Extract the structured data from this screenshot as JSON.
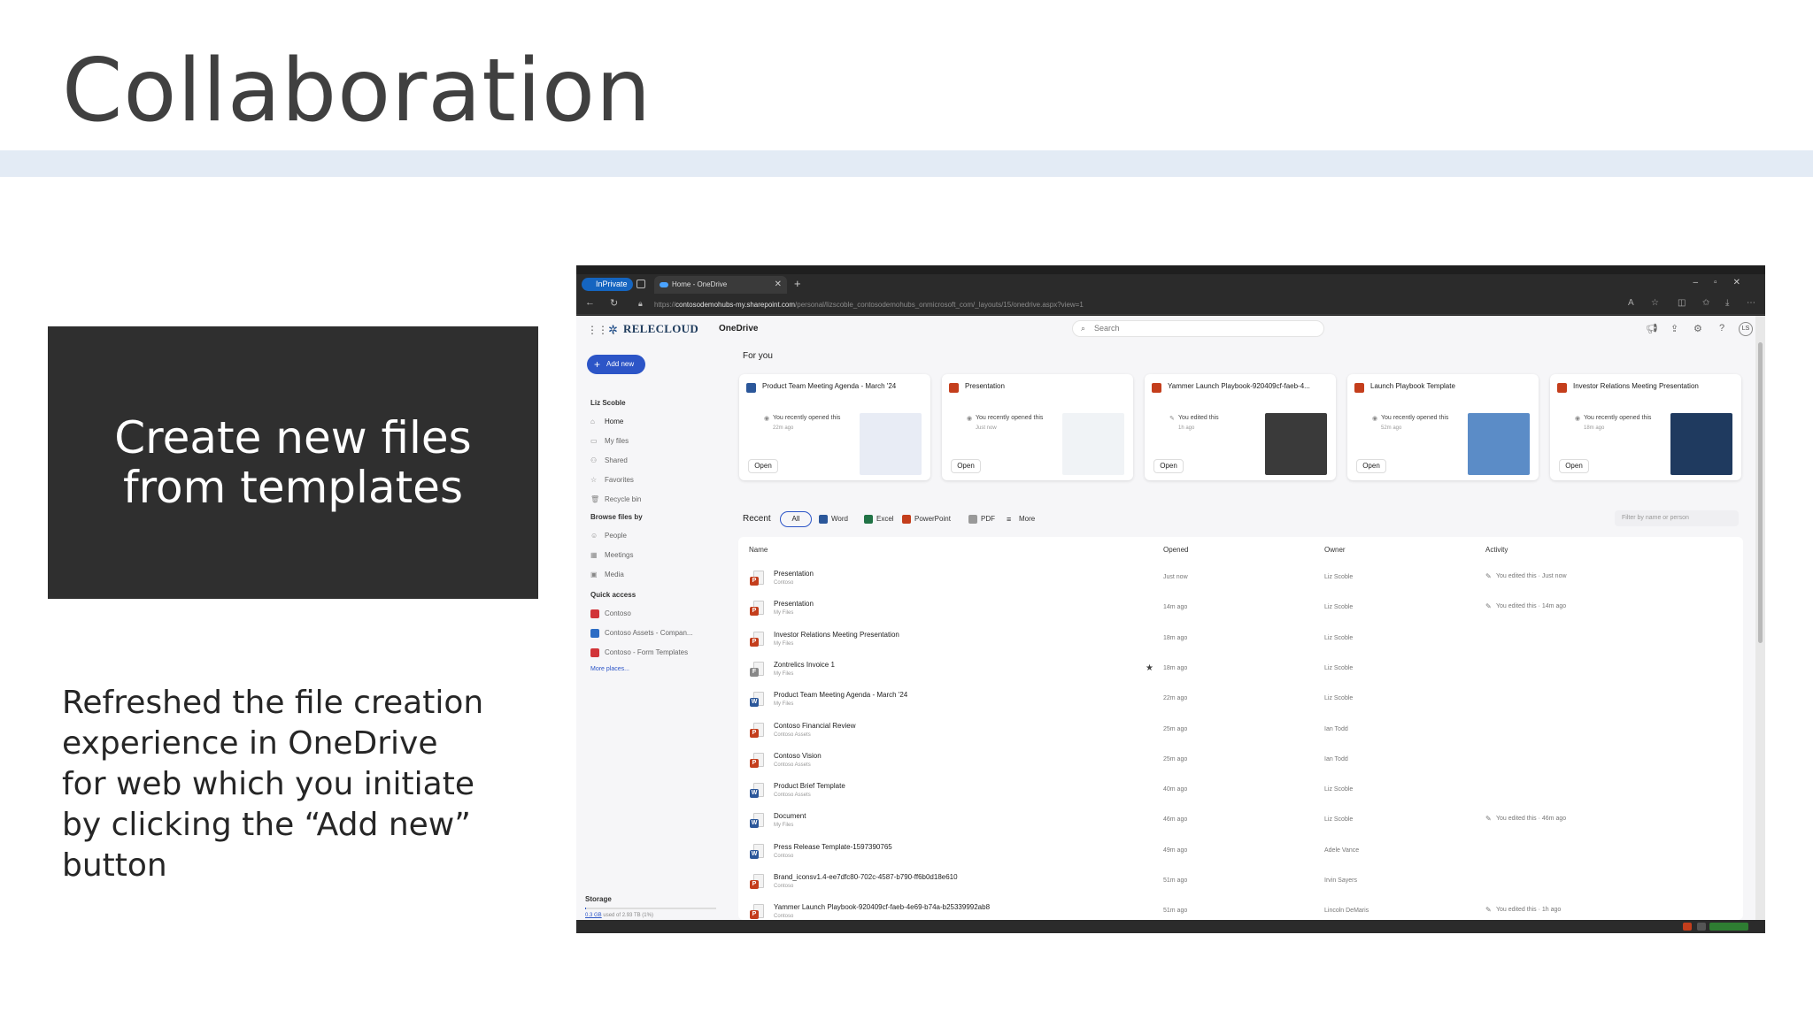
{
  "slide": {
    "title": "Collaboration",
    "callout": "Create new files from templates",
    "body": "Refreshed the file creation experience in OneDrive for web which you initiate by clicking the “Add new” button"
  },
  "browser": {
    "inprivate": "InPrivate",
    "tab_title": "Home - OneDrive",
    "url_prefix": "https://",
    "url_host": "contosodemohubs-my.sharepoint.com",
    "url_path": "/personal/lizscoble_contosodemohubs_onmicrosoft_com/_layouts/15/onedrive.aspx?view=1"
  },
  "app": {
    "brand": "RELECLOUD",
    "name": "OneDrive",
    "search_placeholder": "Search",
    "avatar_initials": "LS"
  },
  "sidebar": {
    "add_new": "Add new",
    "user": "Liz Scoble",
    "nav": [
      {
        "label": "Home",
        "icon": "home-icon"
      },
      {
        "label": "My files",
        "icon": "folder-icon"
      },
      {
        "label": "Shared",
        "icon": "people-icon"
      },
      {
        "label": "Favorites",
        "icon": "star-icon"
      },
      {
        "label": "Recycle bin",
        "icon": "trash-icon"
      }
    ],
    "browse_heading": "Browse files by",
    "browse": [
      {
        "label": "People",
        "icon": "person-icon"
      },
      {
        "label": "Meetings",
        "icon": "calendar-icon"
      },
      {
        "label": "Media",
        "icon": "image-icon"
      }
    ],
    "quick_heading": "Quick access",
    "quick": [
      {
        "label": "Contoso",
        "color": "#d13438"
      },
      {
        "label": "Contoso Assets - Compan...",
        "color": "#2b6cc4"
      },
      {
        "label": "Contoso - Form Templates",
        "color": "#d13438"
      }
    ],
    "more_places": "More places...",
    "storage_heading": "Storage",
    "storage_used": "0.3 GB",
    "storage_rest": " used of 2.93 TB (1%)",
    "storage_fraction": 0.01
  },
  "foryou": {
    "heading": "For you",
    "open_label": "Open",
    "cards": [
      {
        "title": "Product Team Meeting Agenda - March '24",
        "type": "word",
        "color": "#2b579a",
        "activity": "You recently opened this",
        "time": "22m ago",
        "thumb": "#e8ecf5"
      },
      {
        "title": "Presentation",
        "type": "powerpoint",
        "color": "#c43e1c",
        "activity": "You recently opened this",
        "time": "Just now",
        "thumb": "#f0f3f6"
      },
      {
        "title": "Yammer Launch Playbook-920409cf-faeb-4...",
        "type": "powerpoint",
        "color": "#c43e1c",
        "activity": "You edited this",
        "time": "1h ago",
        "thumb": "#3a3a3a"
      },
      {
        "title": "Launch Playbook Template",
        "type": "powerpoint",
        "color": "#c43e1c",
        "activity": "You recently opened this",
        "time": "52m ago",
        "thumb": "#5b8cc7"
      },
      {
        "title": "Investor Relations Meeting Presentation",
        "type": "powerpoint",
        "color": "#c43e1c",
        "activity": "You recently opened this",
        "time": "18m ago",
        "thumb": "#1f3a5f"
      }
    ]
  },
  "recent": {
    "label": "Recent",
    "filters": [
      {
        "label": "All"
      },
      {
        "label": "Word",
        "color": "#2b579a"
      },
      {
        "label": "Excel",
        "color": "#217346"
      },
      {
        "label": "PowerPoint",
        "color": "#c43e1c"
      },
      {
        "label": "PDF",
        "color": "#999999"
      },
      {
        "label": "More",
        "color": "#777777"
      }
    ],
    "filter_placeholder": "Filter by name or person",
    "columns": {
      "name": "Name",
      "opened": "Opened",
      "owner": "Owner",
      "activity": "Activity"
    },
    "rows": [
      {
        "name": "Presentation",
        "loc": "Contoso",
        "kind": "P",
        "color": "#c43e1c",
        "opened": "Just now",
        "owner": "Liz Scoble",
        "activity": "You edited this · Just now",
        "star": false
      },
      {
        "name": "Presentation",
        "loc": "My Files",
        "kind": "P",
        "color": "#c43e1c",
        "opened": "14m ago",
        "owner": "Liz Scoble",
        "activity": "You edited this · 14m ago",
        "star": false
      },
      {
        "name": "Investor Relations Meeting Presentation",
        "loc": "My Files",
        "kind": "P",
        "color": "#c43e1c",
        "opened": "18m ago",
        "owner": "Liz Scoble",
        "activity": "",
        "star": false
      },
      {
        "name": "Zontrelics Invoice 1",
        "loc": "My Files",
        "kind": "F",
        "color": "#888888",
        "opened": "18m ago",
        "owner": "Liz Scoble",
        "activity": "",
        "star": true
      },
      {
        "name": "Product Team Meeting Agenda - March '24",
        "loc": "My Files",
        "kind": "W",
        "color": "#2b579a",
        "opened": "22m ago",
        "owner": "Liz Scoble",
        "activity": "",
        "star": false
      },
      {
        "name": "Contoso Financial Review",
        "loc": "Contoso Assets",
        "kind": "P",
        "color": "#c43e1c",
        "opened": "25m ago",
        "owner": "Ian Todd",
        "activity": "",
        "star": false
      },
      {
        "name": "Contoso Vision",
        "loc": "Contoso Assets",
        "kind": "P",
        "color": "#c43e1c",
        "opened": "25m ago",
        "owner": "Ian Todd",
        "activity": "",
        "star": false
      },
      {
        "name": "Product Brief Template",
        "loc": "Contoso Assets",
        "kind": "W",
        "color": "#2b579a",
        "opened": "40m ago",
        "owner": "Liz Scoble",
        "activity": "",
        "star": false
      },
      {
        "name": "Document",
        "loc": "My Files",
        "kind": "W",
        "color": "#2b579a",
        "opened": "46m ago",
        "owner": "Liz Scoble",
        "activity": "You edited this · 46m ago",
        "star": false
      },
      {
        "name": "Press Release Template-1597390765",
        "loc": "Contoso",
        "kind": "W",
        "color": "#2b579a",
        "opened": "49m ago",
        "owner": "Adele Vance",
        "activity": "",
        "star": false
      },
      {
        "name": "Brand_iconsv1.4-ee7dfc80-702c-4587-b790-ff6b0d18e610",
        "loc": "Contoso",
        "kind": "P",
        "color": "#c43e1c",
        "opened": "51m ago",
        "owner": "Irvin Sayers",
        "activity": "",
        "star": false
      },
      {
        "name": "Yammer Launch Playbook-920409cf-faeb-4e69-b74a-b25339992ab8",
        "loc": "Contoso",
        "kind": "P",
        "color": "#c43e1c",
        "opened": "51m ago",
        "owner": "Lincoln DeMaris",
        "activity": "You edited this · 1h ago",
        "star": false
      }
    ]
  }
}
